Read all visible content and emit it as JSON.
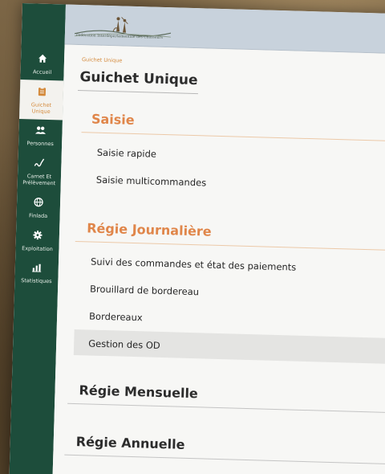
{
  "sidebar": {
    "items": [
      {
        "label": "Accueil",
        "icon": "home-icon"
      },
      {
        "label": "Guichet Unique",
        "icon": "clipboard-icon"
      },
      {
        "label": "Personnes",
        "icon": "people-icon"
      },
      {
        "label": "Carnet Et Prélèvement",
        "icon": "signature-icon"
      },
      {
        "label": "Finlada",
        "icon": "globe-icon"
      },
      {
        "label": "Exploitation",
        "icon": "gear-icon"
      },
      {
        "label": "Statistiques",
        "icon": "bar-chart-icon"
      }
    ],
    "active": "Guichet Unique"
  },
  "header": {
    "logo_text": "Fédération Interdépartementale des Chasseurs"
  },
  "breadcrumb": "Guichet Unique",
  "page_title": "Guichet Unique",
  "sections": {
    "saisie": {
      "title": "Saisie",
      "links": [
        "Saisie rapide",
        "Saisie multicommandes"
      ]
    },
    "regie_journaliere": {
      "title": "Régie Journalière",
      "links": [
        "Suivi des commandes et état des paiements",
        "Brouillard de bordereau",
        "Bordereaux",
        "Gestion des OD"
      ]
    },
    "regie_mensuelle": {
      "title": "Régie Mensuelle"
    },
    "regie_annuelle": {
      "title": "Régie Annuelle"
    }
  },
  "colors": {
    "sidebar": "#1d4d3b",
    "accent": "#e0864a",
    "topbar": "#c8d2dc"
  }
}
